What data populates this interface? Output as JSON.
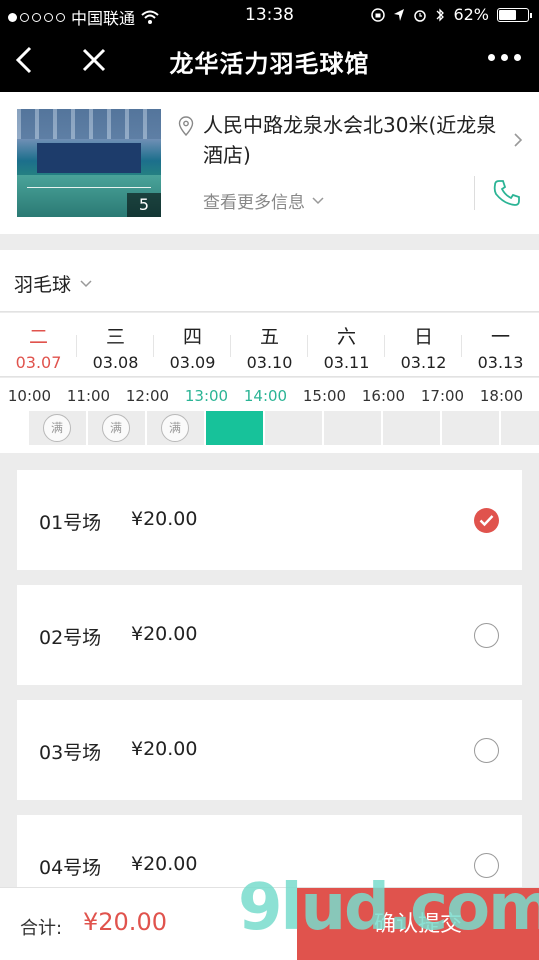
{
  "status_bar": {
    "carrier": "中国联通",
    "time": "13:38",
    "battery": "62%",
    "battery_level": 0.62
  },
  "nav": {
    "title": "龙华活力羽毛球馆"
  },
  "venue": {
    "address": "人民中路龙泉水会北30米(近龙泉酒店)",
    "photo_count": "5",
    "more_info": "查看更多信息"
  },
  "sport": {
    "selected": "羽毛球"
  },
  "dates": [
    {
      "weekday": "二",
      "date": "03.07",
      "active": true
    },
    {
      "weekday": "三",
      "date": "03.08",
      "active": false
    },
    {
      "weekday": "四",
      "date": "03.09",
      "active": false
    },
    {
      "weekday": "五",
      "date": "03.10",
      "active": false
    },
    {
      "weekday": "六",
      "date": "03.11",
      "active": false
    },
    {
      "weekday": "日",
      "date": "03.12",
      "active": false
    },
    {
      "weekday": "一",
      "date": "03.13",
      "active": false
    }
  ],
  "times": {
    "labels": [
      "10:00",
      "11:00",
      "12:00",
      "13:00",
      "14:00",
      "15:00",
      "16:00",
      "17:00",
      "18:00"
    ],
    "selected_range": [
      "13:00",
      "14:00"
    ],
    "full_badge": "满",
    "slots": [
      "full",
      "full",
      "full",
      "selected",
      "available",
      "available",
      "available",
      "available",
      "available"
    ]
  },
  "courts": [
    {
      "name": "01号场",
      "price": "¥20.00",
      "selected": true
    },
    {
      "name": "02号场",
      "price": "¥20.00",
      "selected": false
    },
    {
      "name": "03号场",
      "price": "¥20.00",
      "selected": false
    },
    {
      "name": "04号场",
      "price": "¥20.00",
      "selected": false
    }
  ],
  "footer": {
    "total_label": "合计:",
    "total_value": "¥20.00",
    "submit_label": "确认提交"
  },
  "watermark": "9lud.com",
  "colors": {
    "accent_red": "#e0534d",
    "accent_green": "#17c29a"
  }
}
